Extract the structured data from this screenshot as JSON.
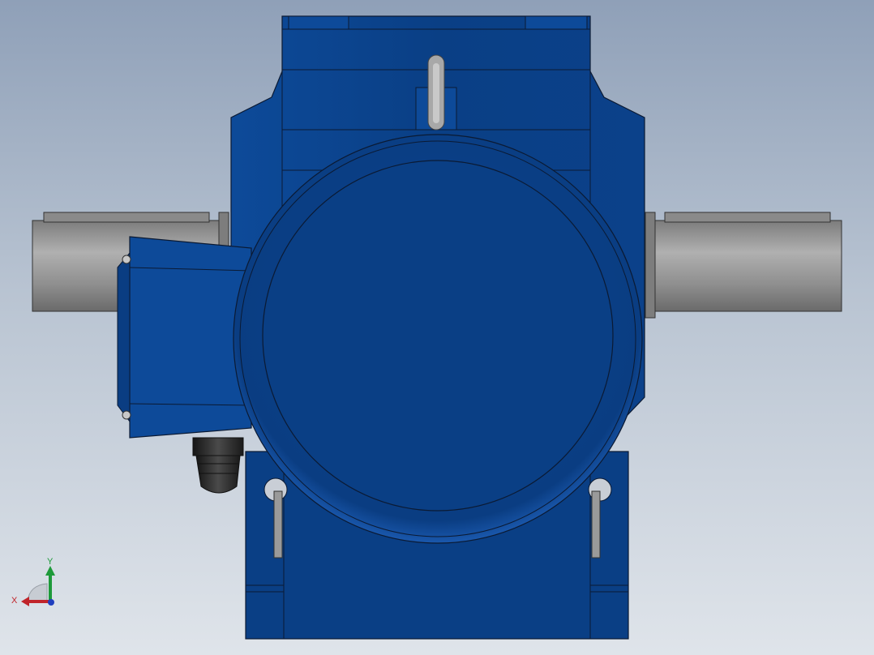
{
  "viewport": {
    "background_top": "#8fa0b8",
    "background_bottom": "#dfe4ea"
  },
  "model": {
    "body_color": "#0a3f85",
    "body_highlight": "#1f5fb8",
    "shaft_color": "#9a9a9a",
    "gland_color": "#2b2b2b",
    "outline_color": "#0b1a33"
  },
  "triad": {
    "x_label": "X",
    "y_label": "Y",
    "x_color": "#c0242a",
    "y_color": "#1e9a3a",
    "z_color": "#1f3fbf"
  }
}
